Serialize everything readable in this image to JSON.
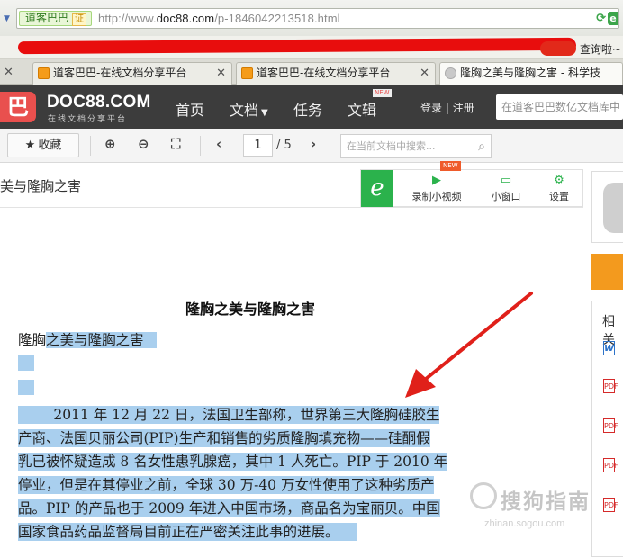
{
  "browser": {
    "site_tag": "道客巴巴",
    "cert_badge": "证",
    "url_prefix": "http://www.",
    "url_domain": "doc88.com",
    "url_path": "/p-1846042213518.html",
    "bookmark_right": "查询啦~"
  },
  "tabs": [
    {
      "label": "道客巴巴-在线文档分享平台",
      "active": false
    },
    {
      "label": "道客巴巴-在线文档分享平台",
      "active": false
    },
    {
      "label": "隆胸之美与隆胸之害 - 科学技",
      "active": true
    }
  ],
  "site": {
    "logo_mark": "巴",
    "logo_text": "DOC88.COM",
    "logo_sub": "在线文档分享平台",
    "nav": [
      "首页",
      "文档",
      "任务",
      "文辑"
    ],
    "new_tag": "NEW",
    "login": "登录",
    "register": "注册",
    "search_placeholder": "在道客巴巴数亿文档库中"
  },
  "toolbar": {
    "favorite": "收藏",
    "page_current": "1",
    "page_total": "/ 5",
    "doc_search_placeholder": "在当前文档中搜索..."
  },
  "doc_title_bar": "美与隆胸之害",
  "tools": {
    "record_video": "录制小视频",
    "new_badge": "NEW",
    "small_window": "小窗口",
    "settings": "设置"
  },
  "sidebar": {
    "related": "相关"
  },
  "document": {
    "heading": "隆胸之美与隆胸之害",
    "line1_plain": "隆胸",
    "line1_hl": "之美与隆胸之害",
    "paragraph": [
      "2011 年 12 月 22 日，法国卫生部称，世界第三大隆胸硅胶生",
      "产商、法国贝丽公司(PIP)生产和销售的劣质隆胸填充物——硅酮假",
      "乳已被怀疑造成 8 名女性患乳腺癌，其中 1 人死亡。PIP 于 2010 年",
      "停业，但是在其停业之前，全球 30 万-40 万女性使用了这种劣质产",
      "品。PIP 的产品也于 2009 年进入中国市场，商品名为宝丽贝。中国",
      "国家食品药品监督局目前正在严密关注此事的进展。"
    ]
  },
  "watermark": {
    "text": "搜狗指南",
    "sub": "zhinan.sogou.com"
  }
}
